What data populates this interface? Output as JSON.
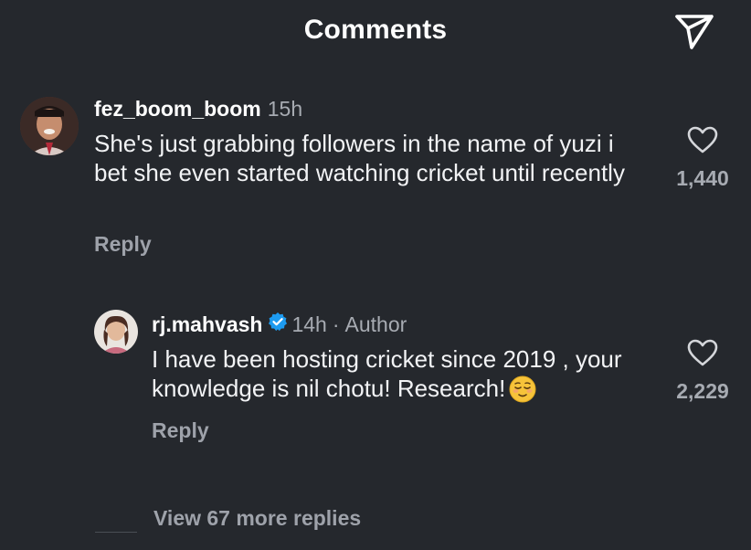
{
  "header": {
    "title": "Comments",
    "share_icon": "paper-plane-icon"
  },
  "comments": [
    {
      "username": "fez_boom_boom",
      "time": "15h",
      "text": "She's just grabbing followers in the name of yuzi i bet she even started watching cricket until recently",
      "reply_label": "Reply",
      "like_count": "1,440",
      "liked": false
    }
  ],
  "reply": {
    "username": "rj.mahvash",
    "verified": true,
    "time": "14h",
    "separator": "·",
    "author_badge": "Author",
    "text": "I have been hosting cricket since 2019 , your knowledge is nil chotu! Research!",
    "emoji": "relieved-face-emoji",
    "reply_label": "Reply",
    "like_count": "2,229",
    "liked": false
  },
  "view_more": {
    "label": "View 67 more replies"
  },
  "colors": {
    "background": "#25282d",
    "text_primary": "#f2f3f5",
    "text_muted": "#a7abb2",
    "verified_blue": "#1d9bf0"
  }
}
